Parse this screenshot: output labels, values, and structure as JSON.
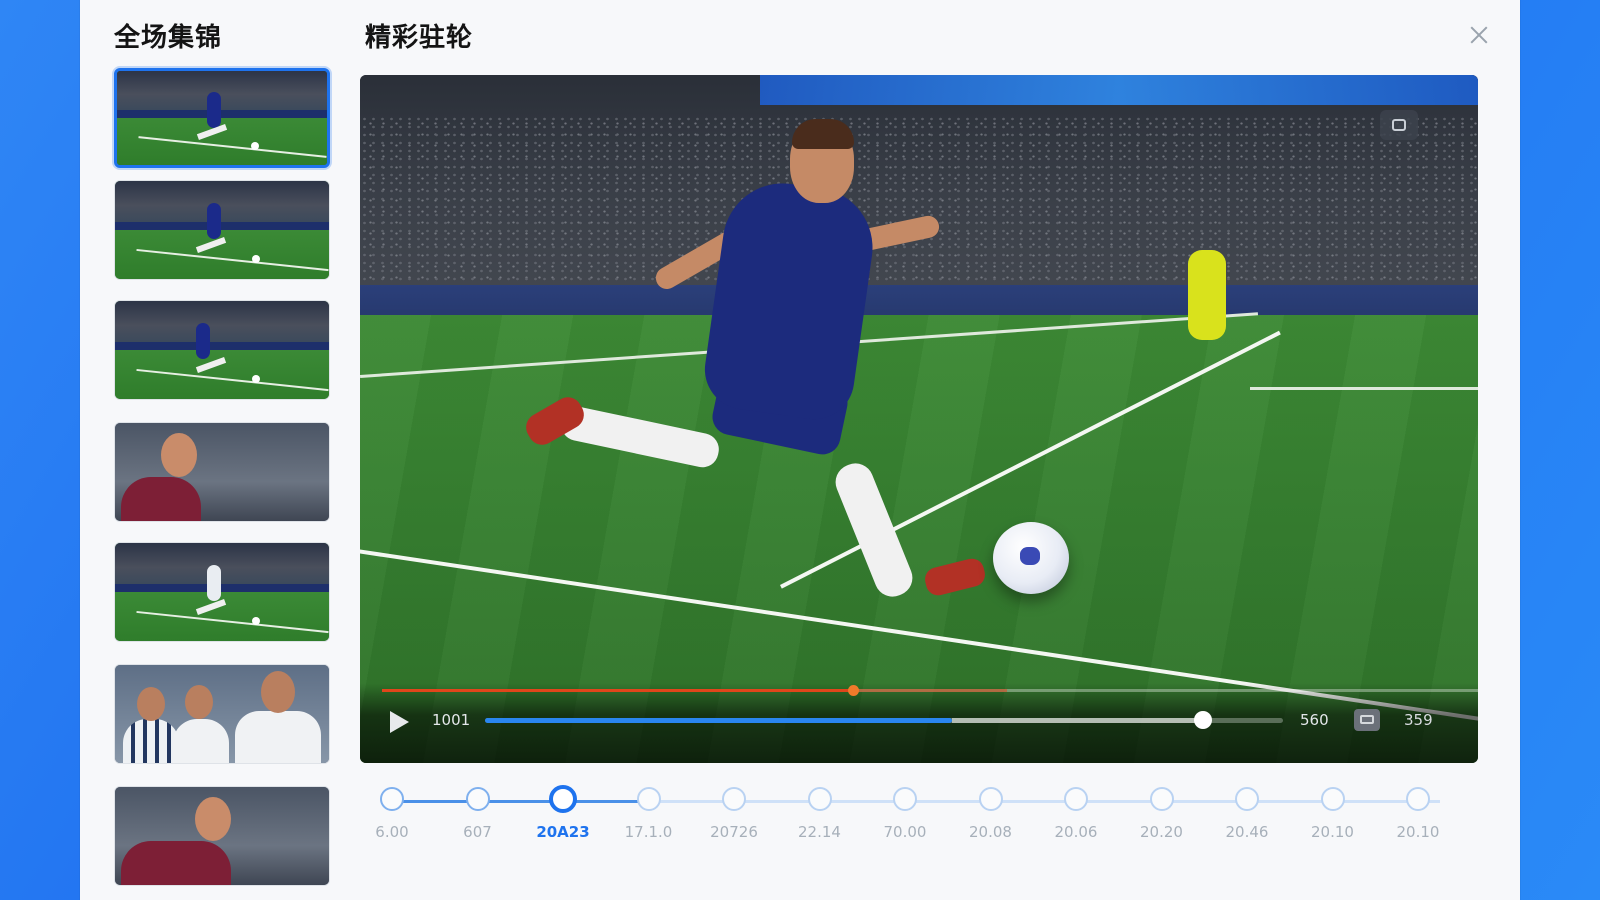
{
  "sidebar": {
    "title": "全场集锦",
    "thumbnails": [
      {
        "kind": "action",
        "selected": true
      },
      {
        "kind": "action",
        "selected": false
      },
      {
        "kind": "action",
        "selected": false
      },
      {
        "kind": "portrait",
        "selected": false
      },
      {
        "kind": "action",
        "selected": false
      },
      {
        "kind": "group",
        "selected": false
      },
      {
        "kind": "portrait",
        "selected": false
      }
    ]
  },
  "main": {
    "title": "精彩驻轮",
    "close_icon": "close-icon"
  },
  "player": {
    "time_current": "1001",
    "time_total": "560",
    "speed": "359",
    "top_progress": 0.43,
    "main_progress": 0.9,
    "buffered": 0.585,
    "colors": {
      "accent": "#1e73ee",
      "top_bar": "#e0461b"
    }
  },
  "timeline": {
    "active_index": 2,
    "labels": [
      "6.00",
      "607",
      "20A23",
      "17.1.0",
      "20726",
      "22.14",
      "70.00",
      "20.08",
      "20.06",
      "20.20",
      "20.46",
      "20.10",
      "20.10"
    ]
  }
}
